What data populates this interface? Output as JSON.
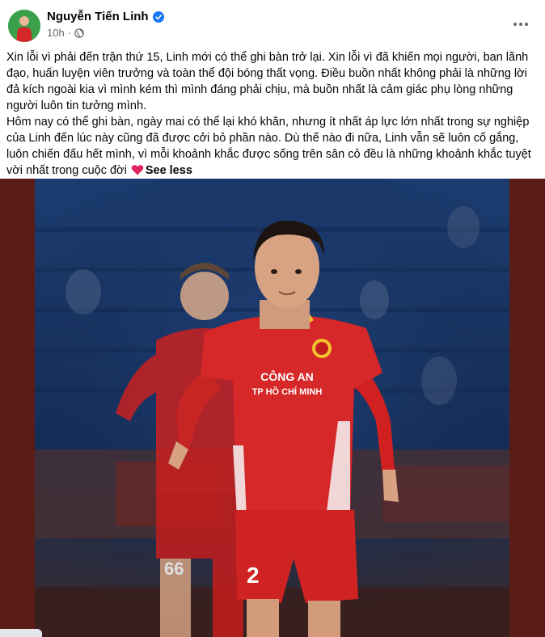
{
  "post": {
    "author": "Nguyễn Tiến Linh",
    "time": "10h",
    "privacy_icon": "globe-icon",
    "more_icon": "ellipsis-icon",
    "paragraph_1": "Xin lỗi vì phải đến trận thứ 15, Linh mới có thể ghi bàn trở lại. Xin lỗi vì đã khiến mọi người, ban lãnh đạo, huấn luyện viên trưởng và toàn thể đội bóng thất vọng. Điều buồn nhất không phải là những lời đả kích ngoài kia vì mình kém thì mình đáng phải chịu, mà buồn nhất là cảm giác phụ lòng những người luôn tin tưởng mình.",
    "paragraph_2": "Hôm nay có thể ghi bàn, ngày mai có thể lại khó khăn, nhưng ít nhất áp lực lớn nhất trong sự nghiệp của Linh đến lúc này cũng đã được cởi bỏ phần nào. Dù thế nào đi nữa, Linh vẫn sẽ luôn cố gắng, luôn chiến đấu hết mình, vì mỗi khoảnh khắc được sống trên sân cỏ đều là những khoảnh khắc tuyệt vời nhất trong cuộc đời",
    "see_less": "See less",
    "heart_icon": "red-heart-emoji-icon"
  },
  "photo": {
    "jersey_text_line1": "CÔNG AN",
    "jersey_text_line2": "TP HỒ CHÍ MINH",
    "player_number_front": "2",
    "teammate_number": "66",
    "colors": {
      "jersey": "#d62828",
      "stadium_bg": "#1d3f77",
      "frame": "#5a1c16"
    }
  }
}
